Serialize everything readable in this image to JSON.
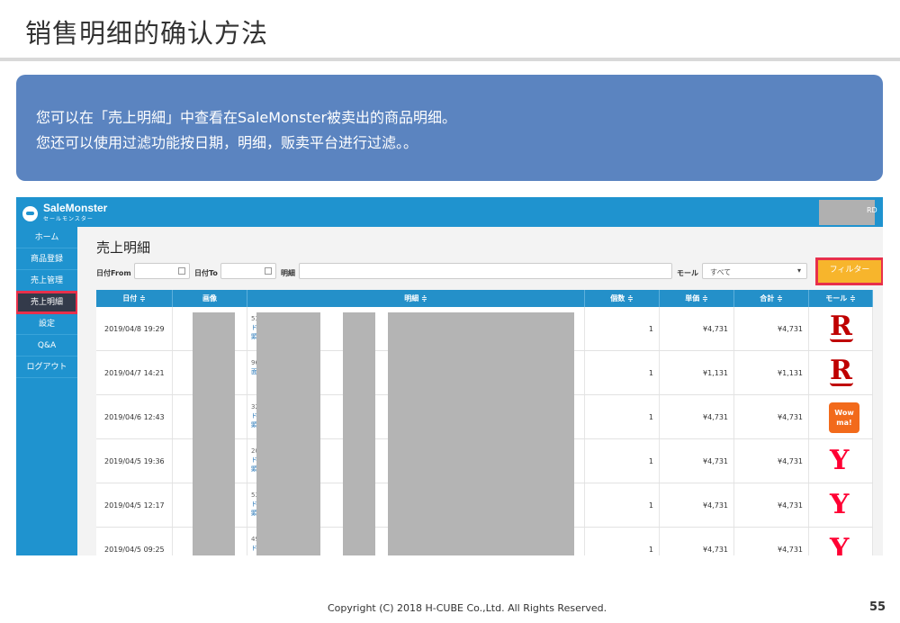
{
  "slide": {
    "title": "销售明细的确认方法",
    "info_line1": "您可以在「売上明細」中查看在SaleMonster被卖出的商品明细。",
    "info_line2": "您还可以使用过滤功能按日期，明细，贩卖平台进行过滤。。",
    "footer": "Copyright (C) 2018 H-CUBE Co.,Ltd. All Rights Reserved.",
    "page_number": "55"
  },
  "app": {
    "brand": "SaleMonster",
    "brand_sub": "セールモンスター",
    "user_text": "RD"
  },
  "sidebar": {
    "items": [
      {
        "label": "ホーム"
      },
      {
        "label": "商品登録"
      },
      {
        "label": "売上管理"
      },
      {
        "label": "売上明細"
      },
      {
        "label": "設定"
      },
      {
        "label": "Q&A"
      },
      {
        "label": "ログアウト"
      }
    ]
  },
  "main": {
    "page_title": "売上明細",
    "date_from_label": "日付From",
    "date_to_label": "日付To",
    "detail_label": "明細",
    "mall_label": "モール",
    "mall_select": "すべて",
    "filter_button": "フィルター"
  },
  "table": {
    "headers": [
      "日付 ≑",
      "画像",
      "明細 ≑",
      "個数 ≑",
      "単価 ≑",
      "合計 ≑",
      "モール ≑"
    ],
    "rows": [
      {
        "date": "2019/04/8 19:29",
        "d1": "53",
        "d2": "ド",
        "d3": "顕",
        "qty": "1",
        "price": "¥4,731",
        "total": "¥4,731",
        "mall": "rakuten"
      },
      {
        "date": "2019/04/7 14:21",
        "d1": "96",
        "d2": "面",
        "d3": "",
        "qty": "1",
        "price": "¥1,131",
        "total": "¥1,131",
        "mall": "rakuten"
      },
      {
        "date": "2019/04/6 12:43",
        "d1": "32",
        "d2": "ド",
        "d3": "顕",
        "qty": "1",
        "price": "¥4,731",
        "total": "¥4,731",
        "mall": "wowma"
      },
      {
        "date": "2019/04/5 19:36",
        "d1": "20",
        "d2": "ド",
        "d3": "顕",
        "qty": "1",
        "price": "¥4,731",
        "total": "¥4,731",
        "mall": "yahoo"
      },
      {
        "date": "2019/04/5 12:17",
        "d1": "53",
        "d2": "ド",
        "d3": "顕",
        "qty": "1",
        "price": "¥4,731",
        "total": "¥4,731",
        "mall": "yahoo"
      },
      {
        "date": "2019/04/5 09:25",
        "d1": "49",
        "d2": "ド",
        "d3": "",
        "qty": "1",
        "price": "¥4,731",
        "total": "¥4,731",
        "mall": "yahoo"
      }
    ]
  },
  "mall_logos": {
    "rakuten": "R",
    "yahoo": "Y",
    "wowma_line1": "Wow",
    "wowma_line2": "ma!"
  },
  "colors": {
    "header_blue": "#1f93cf",
    "info_box": "#5b84c0",
    "highlight_red": "#e8304b",
    "filter_orange": "#f7b52c"
  }
}
